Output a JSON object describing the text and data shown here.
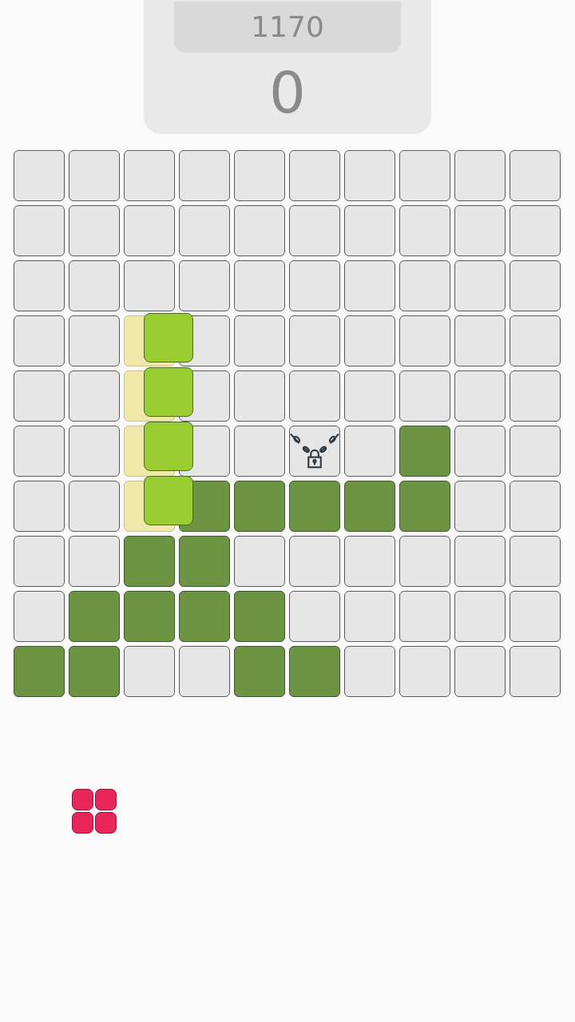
{
  "best_score": "1170",
  "score": "0",
  "board": [
    [
      {
        "kind": "empty"
      },
      {
        "kind": "empty"
      },
      {
        "kind": "empty"
      },
      {
        "kind": "empty"
      },
      {
        "kind": "empty"
      },
      {
        "kind": "empty"
      },
      {
        "kind": "empty"
      },
      {
        "kind": "empty"
      },
      {
        "kind": "empty"
      },
      {
        "kind": "empty"
      }
    ],
    [
      {
        "kind": "empty"
      },
      {
        "kind": "empty"
      },
      {
        "kind": "empty"
      },
      {
        "kind": "empty"
      },
      {
        "kind": "empty"
      },
      {
        "kind": "empty"
      },
      {
        "kind": "empty"
      },
      {
        "kind": "empty"
      },
      {
        "kind": "empty"
      },
      {
        "kind": "empty"
      }
    ],
    [
      {
        "kind": "empty"
      },
      {
        "kind": "empty"
      },
      {
        "kind": "empty"
      },
      {
        "kind": "empty"
      },
      {
        "kind": "empty"
      },
      {
        "kind": "empty"
      },
      {
        "kind": "empty"
      },
      {
        "kind": "empty"
      },
      {
        "kind": "empty"
      },
      {
        "kind": "empty"
      }
    ],
    [
      {
        "kind": "empty"
      },
      {
        "kind": "empty"
      },
      {
        "kind": "preview"
      },
      {
        "kind": "empty"
      },
      {
        "kind": "empty"
      },
      {
        "kind": "empty"
      },
      {
        "kind": "empty"
      },
      {
        "kind": "empty"
      },
      {
        "kind": "empty"
      },
      {
        "kind": "empty"
      }
    ],
    [
      {
        "kind": "empty"
      },
      {
        "kind": "empty"
      },
      {
        "kind": "preview"
      },
      {
        "kind": "empty"
      },
      {
        "kind": "empty"
      },
      {
        "kind": "empty"
      },
      {
        "kind": "empty"
      },
      {
        "kind": "empty"
      },
      {
        "kind": "empty"
      },
      {
        "kind": "empty"
      }
    ],
    [
      {
        "kind": "empty"
      },
      {
        "kind": "empty"
      },
      {
        "kind": "preview"
      },
      {
        "kind": "empty"
      },
      {
        "kind": "empty"
      },
      {
        "kind": "locked"
      },
      {
        "kind": "empty"
      },
      {
        "kind": "filled"
      },
      {
        "kind": "empty"
      },
      {
        "kind": "empty"
      }
    ],
    [
      {
        "kind": "empty"
      },
      {
        "kind": "empty"
      },
      {
        "kind": "preview"
      },
      {
        "kind": "filled"
      },
      {
        "kind": "filled"
      },
      {
        "kind": "filled"
      },
      {
        "kind": "filled"
      },
      {
        "kind": "filled"
      },
      {
        "kind": "empty"
      },
      {
        "kind": "empty"
      }
    ],
    [
      {
        "kind": "empty"
      },
      {
        "kind": "empty"
      },
      {
        "kind": "filled"
      },
      {
        "kind": "filled"
      },
      {
        "kind": "empty"
      },
      {
        "kind": "empty"
      },
      {
        "kind": "empty"
      },
      {
        "kind": "empty"
      },
      {
        "kind": "empty"
      },
      {
        "kind": "empty"
      }
    ],
    [
      {
        "kind": "empty"
      },
      {
        "kind": "filled"
      },
      {
        "kind": "filled"
      },
      {
        "kind": "filled"
      },
      {
        "kind": "filled"
      },
      {
        "kind": "empty"
      },
      {
        "kind": "empty"
      },
      {
        "kind": "empty"
      },
      {
        "kind": "empty"
      },
      {
        "kind": "empty"
      }
    ],
    [
      {
        "kind": "filled"
      },
      {
        "kind": "filled"
      },
      {
        "kind": "empty"
      },
      {
        "kind": "empty"
      },
      {
        "kind": "filled"
      },
      {
        "kind": "filled"
      },
      {
        "kind": "empty"
      },
      {
        "kind": "empty"
      },
      {
        "kind": "empty"
      },
      {
        "kind": "empty"
      }
    ]
  ],
  "dragged_piece": {
    "color": "#9acd32",
    "shape": [
      [
        true
      ],
      [
        true
      ],
      [
        true
      ],
      [
        true
      ]
    ]
  },
  "tray": [
    {
      "color": "#e8265a",
      "shape": [
        [
          true,
          true
        ],
        [
          true,
          true
        ]
      ]
    }
  ]
}
